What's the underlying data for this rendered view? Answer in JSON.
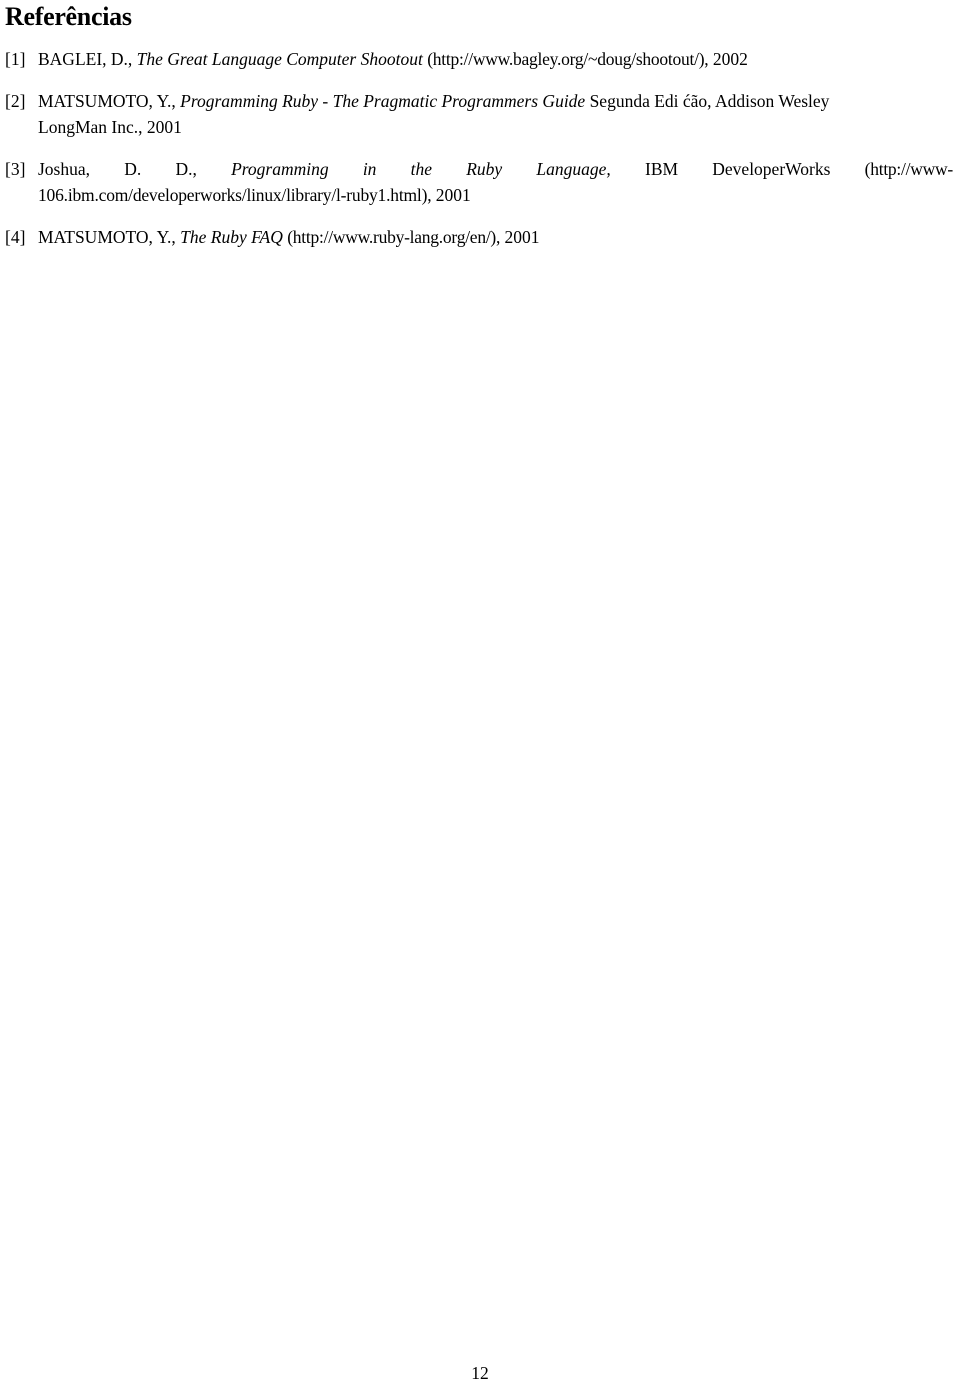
{
  "document": {
    "section_title": "Referências",
    "page_number": "12"
  },
  "references": [
    {
      "marker": "[1]",
      "author": "BAGLEI, D.,",
      "title": "The Great Language Computer Shootout",
      "url": "(http://www.bagley.org/~doug/shootout/),",
      "year": "2002"
    },
    {
      "marker": "[2]",
      "author": "MATSUMOTO, Y.,",
      "title": "Programming Ruby - The Pragmatic Programmers Guide",
      "publisher_line1": "Segunda Edi ćão, Addison Wesley",
      "publisher_line2": "LongMan Inc.,",
      "year": "2001"
    },
    {
      "marker": "[3]",
      "author": "Joshua, D. D.,",
      "title": "Programming in the Ruby Language,",
      "publisher": "IBM DeveloperWorks",
      "url_part1": "(http://www-",
      "url_part2": "106.ibm.com/developerworks/linux/library/l-ruby1.html),",
      "year": "2001"
    },
    {
      "marker": "[4]",
      "author": "MATSUMOTO, Y.,",
      "title": "The Ruby FAQ",
      "url": "(http://www.ruby-lang.org/en/),",
      "year": "2001"
    }
  ]
}
